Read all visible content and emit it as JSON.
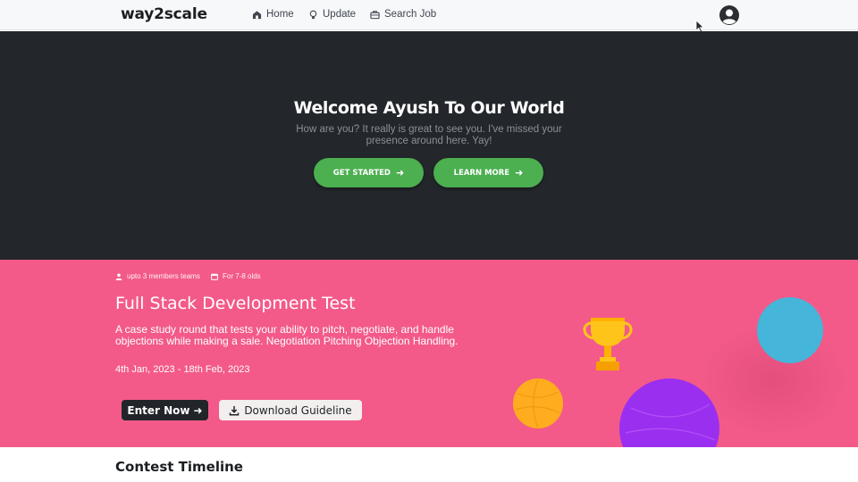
{
  "navbar": {
    "brand": "way2scale",
    "items": [
      {
        "label": "Home",
        "icon": "home-icon"
      },
      {
        "label": "Update",
        "icon": "lightbulb-icon"
      },
      {
        "label": "Search Job",
        "icon": "briefcase-icon"
      }
    ],
    "profile_icon": "user-circle-icon"
  },
  "hero": {
    "title": "Welcome Ayush To Our World",
    "subtitle": "How are you? It really is great to see you. I've missed your presence around here. Yay!",
    "buttons": [
      {
        "label": "GET STARTED",
        "icon": "arrow-right-icon"
      },
      {
        "label": "LEARN MORE",
        "icon": "arrow-right-icon"
      }
    ]
  },
  "contest": {
    "team_size": "upto 3 members teams",
    "age_group": "For 7-8 olds",
    "title": "Full Stack Development Test",
    "description": "A case study round that tests your ability to pitch, negotiate, and handle objections while making a sale. Negotiation Pitching Objection Handling.",
    "dates": "4th Jan, 2023 - 18th Feb, 2023",
    "enter_label": "Enter Now",
    "download_label": "Download Guideline"
  },
  "timeline": {
    "title": "Contest Timeline"
  },
  "colors": {
    "hero_bg": "#23272b",
    "accent_green": "#4caf50",
    "contest_bg": "#f35a89",
    "ball_blue": "#45b5d9",
    "ball_orange": "#ffad1f",
    "ball_purple": "#9b2ff0",
    "trophy_gold": "#ffc41a"
  }
}
